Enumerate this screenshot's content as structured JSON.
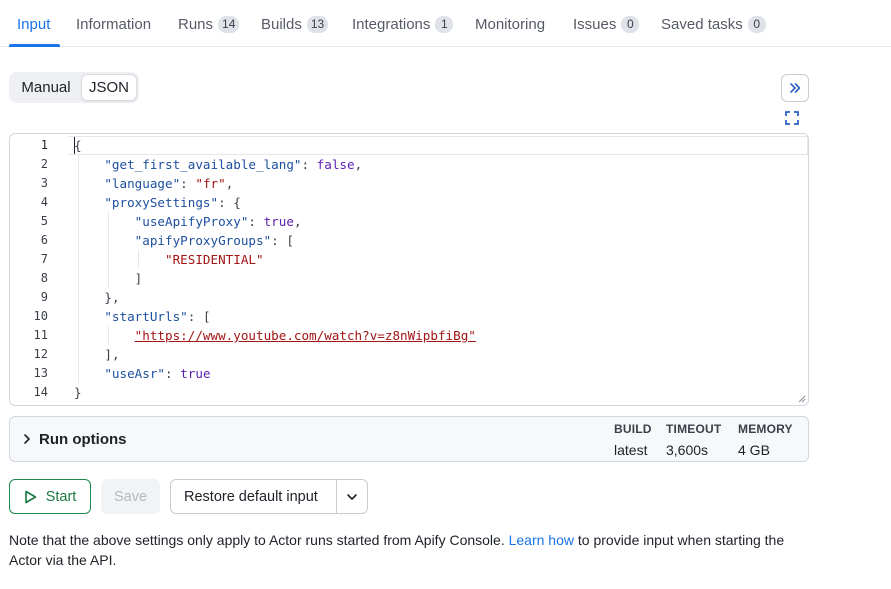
{
  "tabs": [
    {
      "label": "Input",
      "active": true
    },
    {
      "label": "Information"
    },
    {
      "label": "Runs",
      "count": "14"
    },
    {
      "label": "Builds",
      "count": "13"
    },
    {
      "label": "Integrations",
      "count": "1"
    },
    {
      "label": "Monitoring"
    },
    {
      "label": "Issues",
      "count": "0"
    },
    {
      "label": "Saved tasks",
      "count": "0"
    }
  ],
  "mode_toggle": {
    "manual": "Manual",
    "json": "JSON",
    "selected": "JSON"
  },
  "icons": {
    "collapse": "double-chevron-right-icon",
    "expand": "fullscreen-icon",
    "run_options": "chevron-right-icon",
    "start": "play-icon",
    "restore_menu": "chevron-down-icon"
  },
  "editor": {
    "line_numbers": [
      "1",
      "2",
      "3",
      "4",
      "5",
      "6",
      "7",
      "8",
      "9",
      "10",
      "11",
      "12",
      "13",
      "14"
    ],
    "current_line": "1",
    "lines": [
      "{",
      "    \"get_first_available_lang\": false,",
      "    \"language\": \"fr\",",
      "    \"proxySettings\": {",
      "        \"useApifyProxy\": true,",
      "        \"apifyProxyGroups\": [",
      "            \"RESIDENTIAL\"",
      "        ]",
      "    },",
      "    \"startUrls\": [",
      "        \"https://www.youtube.com/watch?v=z8nWipbfiBg\"",
      "    ],",
      "    \"useAsr\": true",
      "}"
    ]
  },
  "run_options": {
    "title": "Run options",
    "build": {
      "label": "BUILD",
      "value": "latest"
    },
    "timeout": {
      "label": "TIMEOUT",
      "value": "3,600s"
    },
    "memory": {
      "label": "MEMORY",
      "value": "4 GB"
    }
  },
  "actions": {
    "start": "Start",
    "save": "Save",
    "restore": "Restore default input"
  },
  "note": {
    "before": "Note that the above settings only apply to Actor runs started from Apify Console.",
    "link": "Learn how",
    "after": "to provide input when starting the Actor via the API."
  },
  "colors": {
    "accent": "#1a73e8",
    "start_green": "#1a7a41",
    "json_key": "#1d4f9e",
    "json_string": "#a31515",
    "json_literal": "#5c1fb3"
  }
}
